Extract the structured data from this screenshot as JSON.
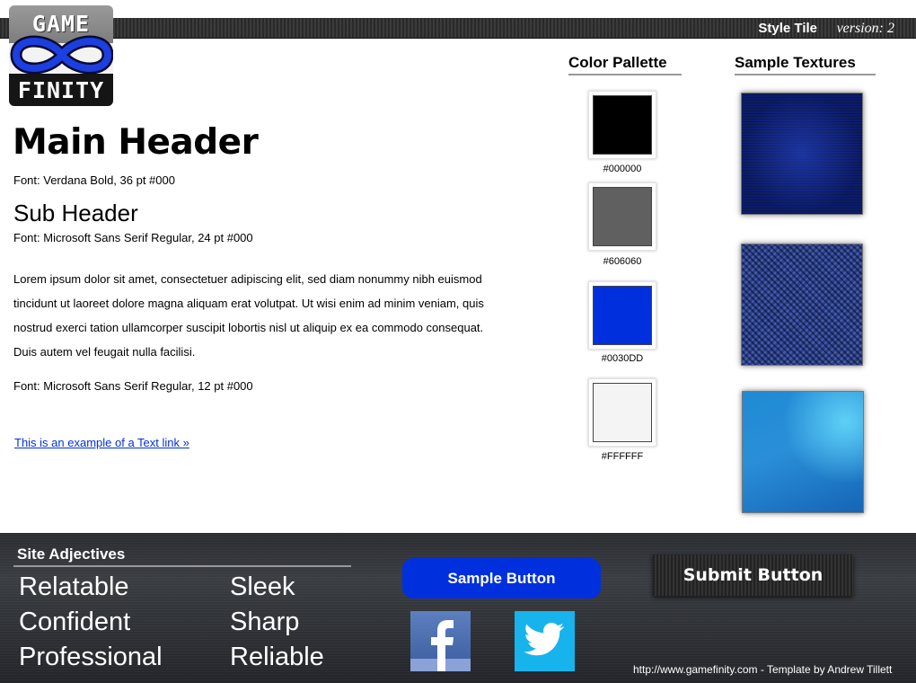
{
  "header": {
    "tile_title": "Style Tile",
    "version": "version: 2"
  },
  "logo": {
    "word_top": "GAME",
    "word_bottom": "FINITY",
    "icon": "infinity-icon"
  },
  "typography": {
    "main_header": "Main Header",
    "main_header_note": "Font: Verdana Bold, 36 pt #000",
    "sub_header": "Sub Header",
    "sub_header_note": "Font: Microsoft Sans Serif Regular, 24 pt #000",
    "body_text": "Lorem ipsum dolor sit amet, consectetuer adipiscing elit, sed diam nonummy nibh euismod tincidunt ut laoreet dolore magna aliquam erat volutpat. Ut wisi enim ad minim veniam, quis nostrud exerci tation ullamcorper suscipit lobortis nisl ut aliquip ex ea commodo consequat. Duis autem vel feugait nulla facilisi.",
    "body_note": "Font: Microsoft Sans Serif Regular, 12 pt #000",
    "text_link": "This is an example of a Text link »"
  },
  "palette": {
    "heading": "Color Pallette",
    "swatches": [
      {
        "label": "#000000",
        "color": "#000000"
      },
      {
        "label": "#606060",
        "color": "#606060"
      },
      {
        "label": "#0030DD",
        "color": "#0030DD"
      },
      {
        "label": "#FFFFFF",
        "color": "#F4F4F4"
      }
    ]
  },
  "textures": {
    "heading": "Sample Textures",
    "items": [
      "dark-blue-mesh-texture",
      "blue-carbon-fiber-texture",
      "light-blue-polygon-texture"
    ]
  },
  "adjectives": {
    "heading": "Site Adjectives",
    "left": [
      "Relatable",
      "Confident",
      "Professional"
    ],
    "right": [
      "Sleek",
      "Sharp",
      "Reliable"
    ]
  },
  "buttons": {
    "sample": "Sample Button",
    "submit": "Submit Button"
  },
  "social": {
    "facebook": "facebook-icon",
    "twitter": "twitter-icon"
  },
  "footer": {
    "credit": "http://www.gamefinity.com - Template by Andrew Tillett"
  },
  "colors": {
    "accent": "#0030DD",
    "link": "#0030DD"
  }
}
